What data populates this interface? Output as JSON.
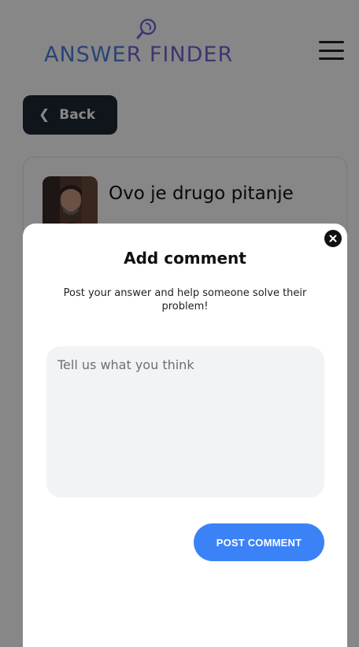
{
  "header": {
    "logo_part1": "ANSWE",
    "logo_part2": "R FINDER",
    "menu_icon": "hamburger-icon"
  },
  "back_button": {
    "label": "Back",
    "icon": "chevron-left-icon"
  },
  "question": {
    "title": "Ovo je drugo pitanje",
    "avatar": "avatar"
  },
  "modal": {
    "title": "Add comment",
    "subtitle": "Post your answer and help someone solve their problem!",
    "input_placeholder": "Tell us what you think",
    "input_value": "",
    "submit_label": "POST COMMENT",
    "close_icon": "close-icon"
  },
  "colors": {
    "logo_blue": "#4f7fe0",
    "logo_purple": "#7a63d8",
    "back_button_bg": "#1f2733",
    "primary_button": "#3b82f6",
    "input_bg": "#f2f3f5",
    "overlay": "rgba(0,0,0,0.47)"
  }
}
